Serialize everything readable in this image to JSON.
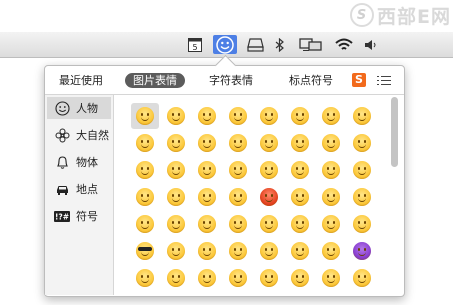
{
  "watermark": {
    "logo_letter": "S",
    "text": "西部E网"
  },
  "menubar": {
    "icons": [
      "calendar-icon",
      "emoji-face-icon",
      "disk-utility-icon",
      "bluetooth-icon",
      "displays-icon",
      "wifi-icon",
      "volume-icon"
    ],
    "calendar_day": "5"
  },
  "popup": {
    "tabs": [
      {
        "label": "最近使用",
        "active": false
      },
      {
        "label": "图片表情",
        "active": true
      },
      {
        "label": "字符表情",
        "active": false
      },
      {
        "label": "标点符号",
        "active": false
      }
    ],
    "brand_letter": "S",
    "brand_color": "#f26a1c",
    "sidebar": [
      {
        "label": "人物",
        "icon": "smiley-icon",
        "selected": true
      },
      {
        "label": "大自然",
        "icon": "flower-icon",
        "selected": false
      },
      {
        "label": "物体",
        "icon": "bell-icon",
        "selected": false
      },
      {
        "label": "地点",
        "icon": "car-icon",
        "selected": false
      },
      {
        "label": "符号",
        "icon": "symbols-icon",
        "selected": false
      }
    ],
    "symbols_icon_text": "!?#",
    "emoji_rows": 7,
    "emoji_cols": 8,
    "selected_emoji": "grinning"
  },
  "colors": {
    "accent": "#4d7fe5",
    "tab_active": "#5c5c5c"
  }
}
